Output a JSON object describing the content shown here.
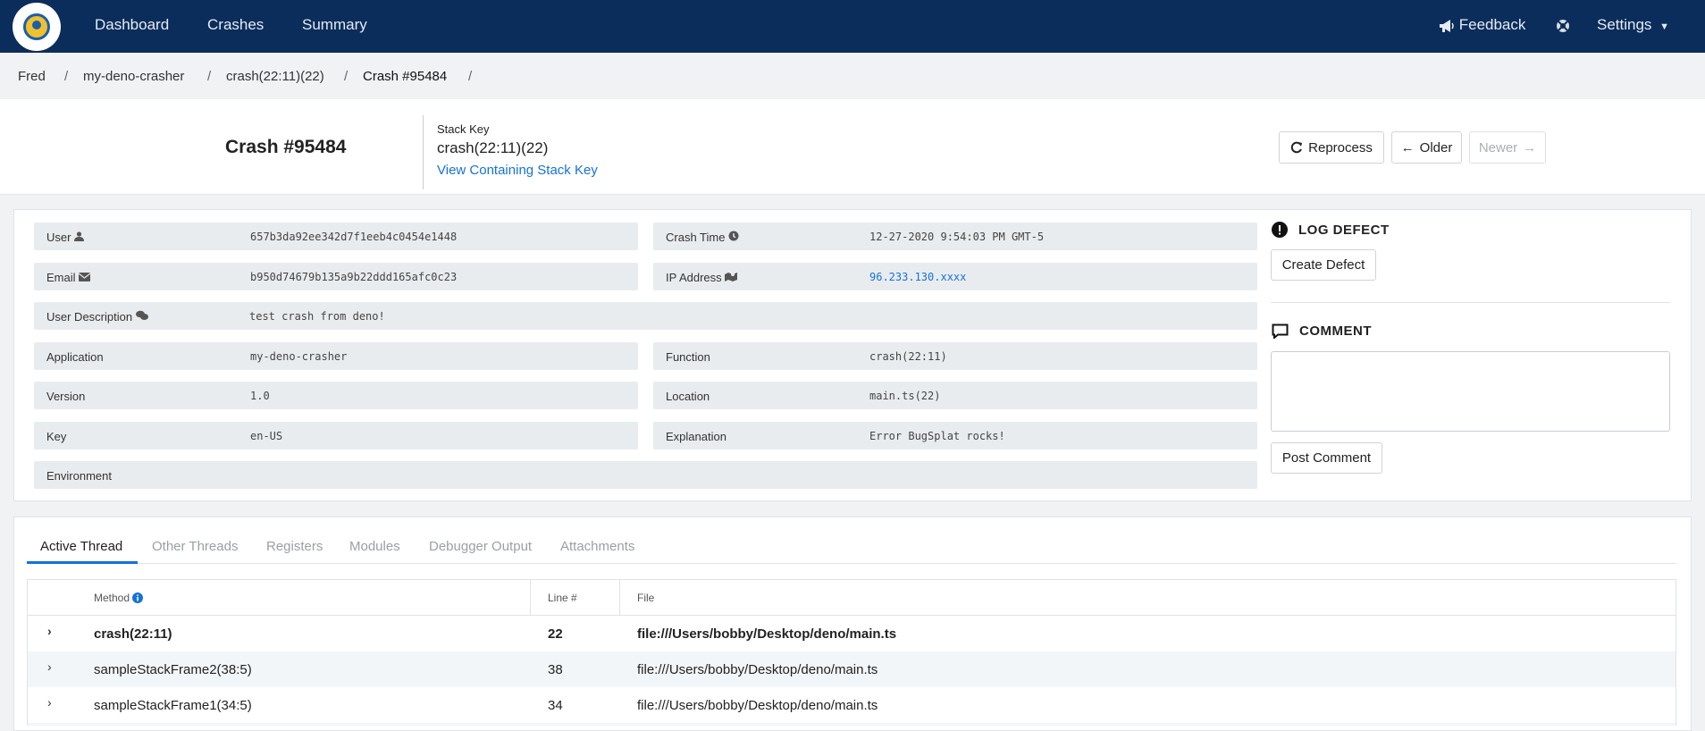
{
  "nav": {
    "links": [
      "Dashboard",
      "Crashes",
      "Summary"
    ],
    "feedback": "Feedback",
    "settings": "Settings"
  },
  "breadcrumb": [
    "Fred",
    "my-deno-crasher",
    "crash(22:11)(22)",
    "Crash #95484"
  ],
  "header": {
    "title": "Crash #95484",
    "stack_key_label": "Stack Key",
    "stack_key_value": "crash(22:11)(22)",
    "stack_key_link": "View Containing Stack Key",
    "reprocess": "Reprocess",
    "older": "Older",
    "newer": "Newer"
  },
  "details": {
    "user": {
      "label": "User",
      "value": "657b3da92ee342d7f1eeb4c0454e1448"
    },
    "crash_time": {
      "label": "Crash Time",
      "value": "12-27-2020 9:54:03 PM GMT-5"
    },
    "email": {
      "label": "Email",
      "value": "b950d74679b135a9b22ddd165afc0c23"
    },
    "ip": {
      "label": "IP Address",
      "value": "96.233.130.xxxx"
    },
    "user_description": {
      "label": "User Description",
      "value": "test crash from deno!"
    },
    "application": {
      "label": "Application",
      "value": "my-deno-crasher"
    },
    "function": {
      "label": "Function",
      "value": "crash(22:11)"
    },
    "version": {
      "label": "Version",
      "value": "1.0"
    },
    "location": {
      "label": "Location",
      "value": "main.ts(22)"
    },
    "key": {
      "label": "Key",
      "value": "en-US"
    },
    "explanation": {
      "label": "Explanation",
      "value": "Error BugSplat rocks!"
    },
    "environment": {
      "label": "Environment",
      "value": ""
    }
  },
  "side": {
    "log_defect": "LOG DEFECT",
    "create_defect": "Create Defect",
    "comment": "COMMENT",
    "comment_value": "",
    "post_comment": "Post Comment"
  },
  "tabs": [
    "Active Thread",
    "Other Threads",
    "Registers",
    "Modules",
    "Debugger Output",
    "Attachments"
  ],
  "table": {
    "headers": {
      "method": "Method",
      "line": "Line #",
      "file": "File"
    },
    "rows": [
      {
        "method": "crash(22:11)",
        "line": "22",
        "file": "file:///Users/bobby/Desktop/deno/main.ts"
      },
      {
        "method": "sampleStackFrame2(38:5)",
        "line": "38",
        "file": "file:///Users/bobby/Desktop/deno/main.ts"
      },
      {
        "method": "sampleStackFrame1(34:5)",
        "line": "34",
        "file": "file:///Users/bobby/Desktop/deno/main.ts"
      }
    ]
  },
  "colors": {
    "nav_bg": "#0b2d5b",
    "link": "#1572d8",
    "row_bg": "#e9ecef"
  }
}
